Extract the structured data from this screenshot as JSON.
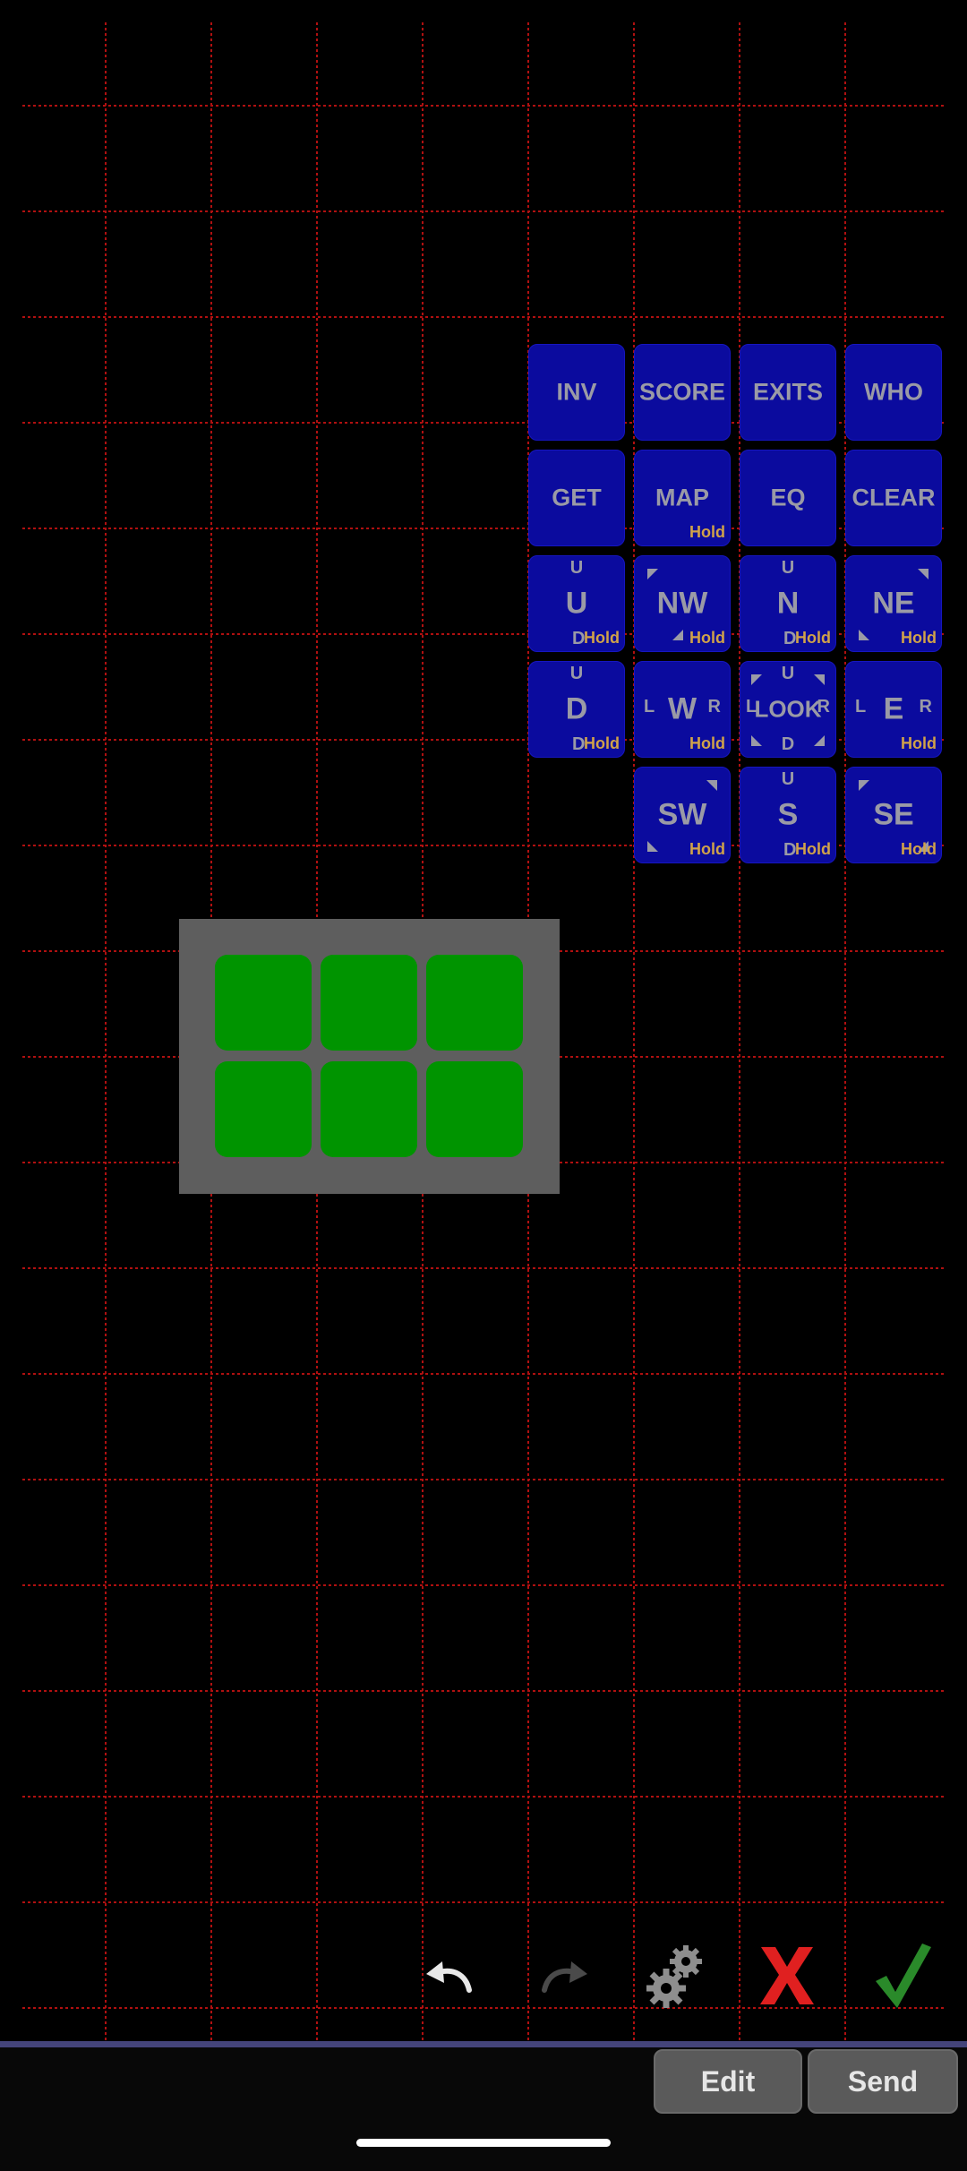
{
  "buttons": {
    "inv": {
      "label": "INV"
    },
    "score": {
      "label": "SCORE"
    },
    "exits": {
      "label": "EXITS"
    },
    "who": {
      "label": "WHO"
    },
    "get": {
      "label": "GET"
    },
    "map": {
      "label": "MAP",
      "hold": "Hold"
    },
    "eq": {
      "label": "EQ"
    },
    "clear": {
      "label": "CLEAR"
    },
    "up": {
      "label": "U",
      "up": "U",
      "down": "D",
      "hold": "Hold"
    },
    "nw": {
      "label": "NW",
      "hold": "Hold"
    },
    "n": {
      "label": "N",
      "up": "U",
      "down": "D",
      "hold": "Hold"
    },
    "ne": {
      "label": "NE",
      "hold": "Hold"
    },
    "down": {
      "label": "D",
      "up": "U",
      "down": "D",
      "hold": "Hold"
    },
    "w": {
      "label": "W",
      "left": "L",
      "right": "R",
      "hold": "Hold"
    },
    "look": {
      "label": "LOOK",
      "up": "U",
      "down": "D",
      "left": "L",
      "right": "R"
    },
    "e": {
      "label": "E",
      "left": "L",
      "right": "R",
      "hold": "Hold"
    },
    "sw": {
      "label": "SW",
      "hold": "Hold"
    },
    "s": {
      "label": "S",
      "up": "U",
      "down": "D",
      "hold": "Hold"
    },
    "se": {
      "label": "SE",
      "hold": "Hold"
    }
  },
  "toolbar": {
    "undo_icon": "undo-icon",
    "redo_icon": "redo-icon",
    "settings_icon": "gear-icon",
    "cancel_icon": "close-icon",
    "confirm_icon": "checkmark-icon"
  },
  "bottom": {
    "edit_label": "Edit",
    "send_label": "Send"
  },
  "colors": {
    "button_blue": "#0b0b9e",
    "grid_red": "#b01010",
    "cell_green": "#009400",
    "hold_orange": "#d0a24a",
    "cancel_red": "#e02020",
    "confirm_green": "#2a8a2a"
  }
}
